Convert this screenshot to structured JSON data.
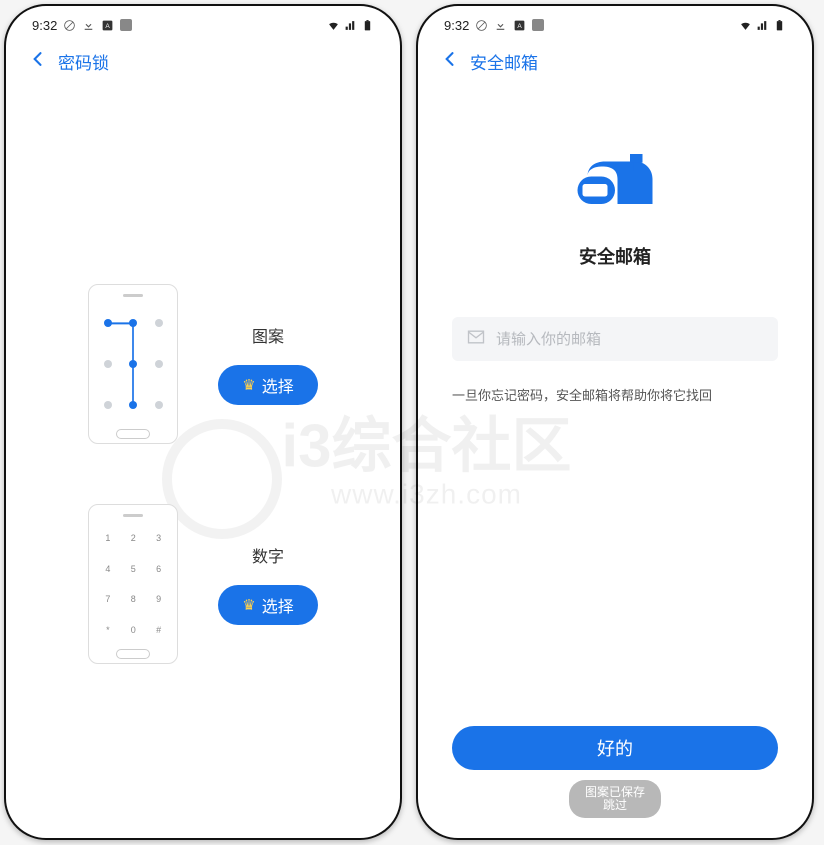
{
  "status": {
    "time": "9:32",
    "icons_left": [
      "no-sim-icon",
      "download-icon",
      "app-a-icon",
      "square-icon"
    ],
    "icons_right": [
      "wifi-icon",
      "signal-icon",
      "battery-icon"
    ]
  },
  "left": {
    "header_title": "密码锁",
    "pattern": {
      "label": "图案",
      "button": "选择"
    },
    "pin": {
      "label": "数字",
      "button": "选择"
    },
    "keypad": [
      "1",
      "2",
      "3",
      "4",
      "5",
      "6",
      "7",
      "8",
      "9",
      "*",
      "0",
      "#"
    ]
  },
  "right": {
    "header_title": "安全邮箱",
    "title": "安全邮箱",
    "placeholder": "请输入你的邮箱",
    "hint": "一旦你忘记密码，安全邮箱将帮助你将它找回",
    "ok_button": "好的",
    "toast_line1": "图案已保存",
    "toast_line2": "跳过"
  },
  "watermark": {
    "main": "i3综合社区",
    "url": "www.i3zh.com"
  },
  "colors": {
    "accent": "#1a73e8"
  }
}
